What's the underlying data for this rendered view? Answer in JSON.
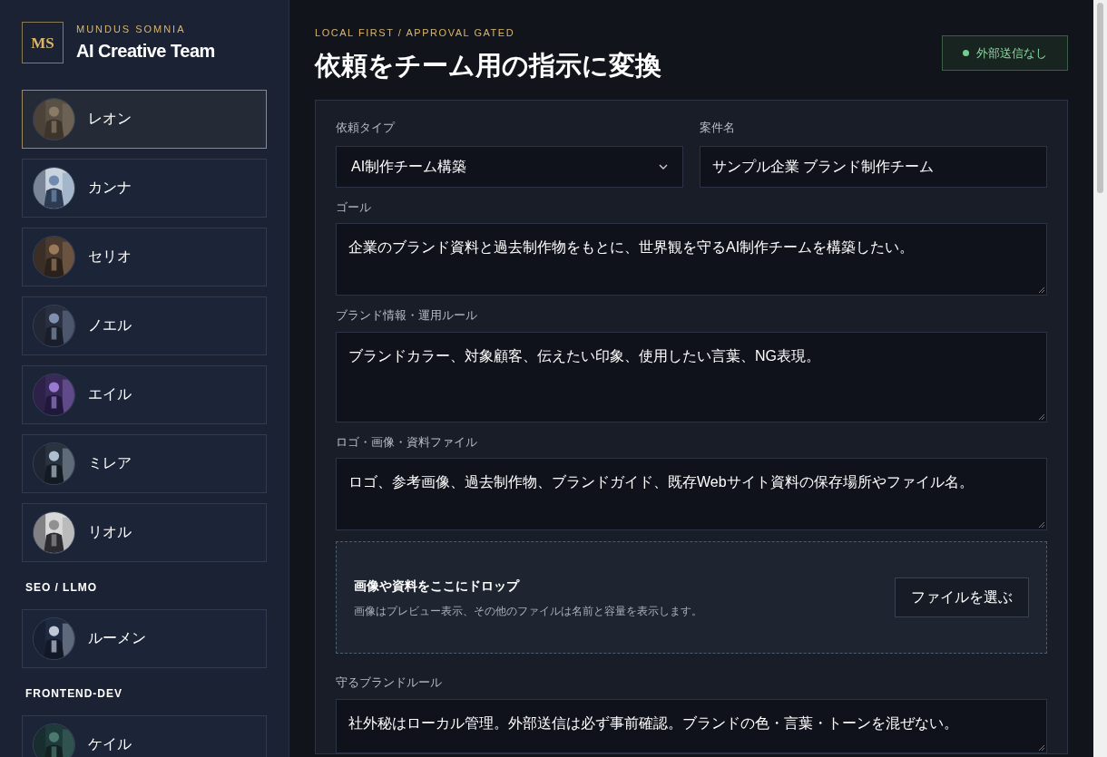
{
  "sidebar": {
    "logo": "MS",
    "eyebrow": "MUNDUS SOMNIA",
    "title": "AI Creative Team",
    "groups": [
      {
        "members": [
          {
            "name": "レオン",
            "selected": true
          },
          {
            "name": "カンナ",
            "selected": false
          },
          {
            "name": "セリオ",
            "selected": false
          },
          {
            "name": "ノエル",
            "selected": false
          },
          {
            "name": "エイル",
            "selected": false
          },
          {
            "name": "ミレア",
            "selected": false
          },
          {
            "name": "リオル",
            "selected": false
          }
        ]
      },
      {
        "heading": "SEO / LLMO",
        "members": [
          {
            "name": "ルーメン",
            "selected": false
          }
        ]
      },
      {
        "heading": "FRONTEND-DEV",
        "members": [
          {
            "name": "ケイル",
            "selected": false
          }
        ]
      }
    ]
  },
  "header": {
    "eyebrow": "LOCAL FIRST / APPROVAL GATED",
    "title": "依頼をチーム用の指示に変換",
    "status": "外部送信なし"
  },
  "form": {
    "top_fields": [
      {
        "kind": "select",
        "label": "依頼タイプ",
        "value": "AI制作チーム構築"
      },
      {
        "kind": "text",
        "label": "案件名",
        "value": "サンプル企業 ブランド制作チーム"
      }
    ],
    "fields": [
      {
        "kind": "textarea",
        "label": "ゴール",
        "value": "企業のブランド資料と過去制作物をもとに、世界観を守るAI制作チームを構築したい。"
      },
      {
        "kind": "textarea",
        "label": "ブランド情報・運用ルール",
        "value": "ブランドカラー、対象顧客、伝えたい印象、使用したい言葉、NG表現。"
      },
      {
        "kind": "textarea",
        "label": "ロゴ・画像・資料ファイル",
        "value": "ロゴ、参考画像、過去制作物、ブランドガイド、既存Webサイト資料の保存場所やファイル名。"
      },
      {
        "kind": "dropzone",
        "title": "画像や資料をここにドロップ",
        "hint": "画像はプレビュー表示、その他のファイルは名前と容量を表示します。",
        "button": "ファイルを選ぶ"
      },
      {
        "kind": "textarea",
        "label": "守るブランドルール",
        "value": "社外秘はローカル管理。外部送信は必ず事前確認。ブランドの色・言葉・トーンを混ぜない。"
      }
    ]
  }
}
